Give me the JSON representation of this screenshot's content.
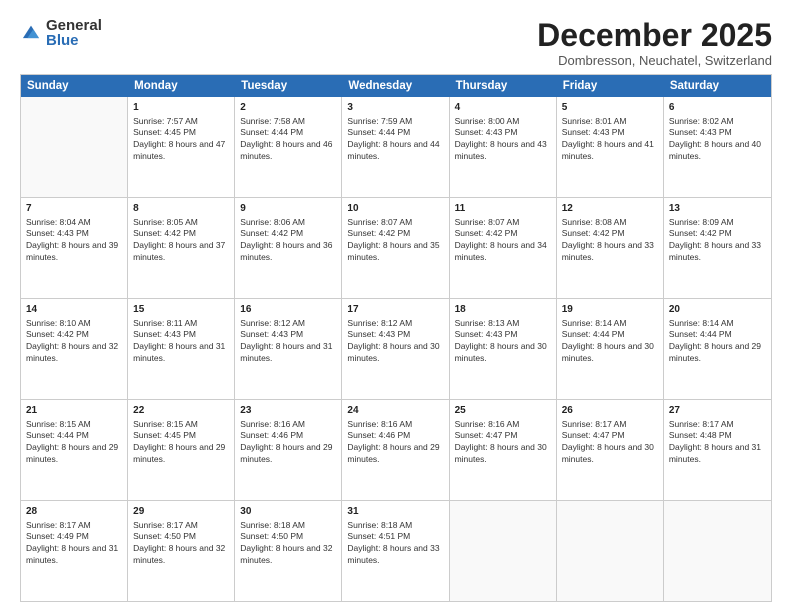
{
  "logo": {
    "general": "General",
    "blue": "Blue"
  },
  "title": {
    "month": "December 2025",
    "location": "Dombresson, Neuchatel, Switzerland"
  },
  "calendar": {
    "headers": [
      "Sunday",
      "Monday",
      "Tuesday",
      "Wednesday",
      "Thursday",
      "Friday",
      "Saturday"
    ],
    "rows": [
      [
        {
          "day": "",
          "sunrise": "",
          "sunset": "",
          "daylight": "",
          "empty": true
        },
        {
          "day": "1",
          "sunrise": "Sunrise: 7:57 AM",
          "sunset": "Sunset: 4:45 PM",
          "daylight": "Daylight: 8 hours and 47 minutes."
        },
        {
          "day": "2",
          "sunrise": "Sunrise: 7:58 AM",
          "sunset": "Sunset: 4:44 PM",
          "daylight": "Daylight: 8 hours and 46 minutes."
        },
        {
          "day": "3",
          "sunrise": "Sunrise: 7:59 AM",
          "sunset": "Sunset: 4:44 PM",
          "daylight": "Daylight: 8 hours and 44 minutes."
        },
        {
          "day": "4",
          "sunrise": "Sunrise: 8:00 AM",
          "sunset": "Sunset: 4:43 PM",
          "daylight": "Daylight: 8 hours and 43 minutes."
        },
        {
          "day": "5",
          "sunrise": "Sunrise: 8:01 AM",
          "sunset": "Sunset: 4:43 PM",
          "daylight": "Daylight: 8 hours and 41 minutes."
        },
        {
          "day": "6",
          "sunrise": "Sunrise: 8:02 AM",
          "sunset": "Sunset: 4:43 PM",
          "daylight": "Daylight: 8 hours and 40 minutes."
        }
      ],
      [
        {
          "day": "7",
          "sunrise": "Sunrise: 8:04 AM",
          "sunset": "Sunset: 4:43 PM",
          "daylight": "Daylight: 8 hours and 39 minutes."
        },
        {
          "day": "8",
          "sunrise": "Sunrise: 8:05 AM",
          "sunset": "Sunset: 4:42 PM",
          "daylight": "Daylight: 8 hours and 37 minutes."
        },
        {
          "day": "9",
          "sunrise": "Sunrise: 8:06 AM",
          "sunset": "Sunset: 4:42 PM",
          "daylight": "Daylight: 8 hours and 36 minutes."
        },
        {
          "day": "10",
          "sunrise": "Sunrise: 8:07 AM",
          "sunset": "Sunset: 4:42 PM",
          "daylight": "Daylight: 8 hours and 35 minutes."
        },
        {
          "day": "11",
          "sunrise": "Sunrise: 8:07 AM",
          "sunset": "Sunset: 4:42 PM",
          "daylight": "Daylight: 8 hours and 34 minutes."
        },
        {
          "day": "12",
          "sunrise": "Sunrise: 8:08 AM",
          "sunset": "Sunset: 4:42 PM",
          "daylight": "Daylight: 8 hours and 33 minutes."
        },
        {
          "day": "13",
          "sunrise": "Sunrise: 8:09 AM",
          "sunset": "Sunset: 4:42 PM",
          "daylight": "Daylight: 8 hours and 33 minutes."
        }
      ],
      [
        {
          "day": "14",
          "sunrise": "Sunrise: 8:10 AM",
          "sunset": "Sunset: 4:42 PM",
          "daylight": "Daylight: 8 hours and 32 minutes."
        },
        {
          "day": "15",
          "sunrise": "Sunrise: 8:11 AM",
          "sunset": "Sunset: 4:43 PM",
          "daylight": "Daylight: 8 hours and 31 minutes."
        },
        {
          "day": "16",
          "sunrise": "Sunrise: 8:12 AM",
          "sunset": "Sunset: 4:43 PM",
          "daylight": "Daylight: 8 hours and 31 minutes."
        },
        {
          "day": "17",
          "sunrise": "Sunrise: 8:12 AM",
          "sunset": "Sunset: 4:43 PM",
          "daylight": "Daylight: 8 hours and 30 minutes."
        },
        {
          "day": "18",
          "sunrise": "Sunrise: 8:13 AM",
          "sunset": "Sunset: 4:43 PM",
          "daylight": "Daylight: 8 hours and 30 minutes."
        },
        {
          "day": "19",
          "sunrise": "Sunrise: 8:14 AM",
          "sunset": "Sunset: 4:44 PM",
          "daylight": "Daylight: 8 hours and 30 minutes."
        },
        {
          "day": "20",
          "sunrise": "Sunrise: 8:14 AM",
          "sunset": "Sunset: 4:44 PM",
          "daylight": "Daylight: 8 hours and 29 minutes."
        }
      ],
      [
        {
          "day": "21",
          "sunrise": "Sunrise: 8:15 AM",
          "sunset": "Sunset: 4:44 PM",
          "daylight": "Daylight: 8 hours and 29 minutes."
        },
        {
          "day": "22",
          "sunrise": "Sunrise: 8:15 AM",
          "sunset": "Sunset: 4:45 PM",
          "daylight": "Daylight: 8 hours and 29 minutes."
        },
        {
          "day": "23",
          "sunrise": "Sunrise: 8:16 AM",
          "sunset": "Sunset: 4:46 PM",
          "daylight": "Daylight: 8 hours and 29 minutes."
        },
        {
          "day": "24",
          "sunrise": "Sunrise: 8:16 AM",
          "sunset": "Sunset: 4:46 PM",
          "daylight": "Daylight: 8 hours and 29 minutes."
        },
        {
          "day": "25",
          "sunrise": "Sunrise: 8:16 AM",
          "sunset": "Sunset: 4:47 PM",
          "daylight": "Daylight: 8 hours and 30 minutes."
        },
        {
          "day": "26",
          "sunrise": "Sunrise: 8:17 AM",
          "sunset": "Sunset: 4:47 PM",
          "daylight": "Daylight: 8 hours and 30 minutes."
        },
        {
          "day": "27",
          "sunrise": "Sunrise: 8:17 AM",
          "sunset": "Sunset: 4:48 PM",
          "daylight": "Daylight: 8 hours and 31 minutes."
        }
      ],
      [
        {
          "day": "28",
          "sunrise": "Sunrise: 8:17 AM",
          "sunset": "Sunset: 4:49 PM",
          "daylight": "Daylight: 8 hours and 31 minutes."
        },
        {
          "day": "29",
          "sunrise": "Sunrise: 8:17 AM",
          "sunset": "Sunset: 4:50 PM",
          "daylight": "Daylight: 8 hours and 32 minutes."
        },
        {
          "day": "30",
          "sunrise": "Sunrise: 8:18 AM",
          "sunset": "Sunset: 4:50 PM",
          "daylight": "Daylight: 8 hours and 32 minutes."
        },
        {
          "day": "31",
          "sunrise": "Sunrise: 8:18 AM",
          "sunset": "Sunset: 4:51 PM",
          "daylight": "Daylight: 8 hours and 33 minutes."
        },
        {
          "day": "",
          "sunrise": "",
          "sunset": "",
          "daylight": "",
          "empty": true
        },
        {
          "day": "",
          "sunrise": "",
          "sunset": "",
          "daylight": "",
          "empty": true
        },
        {
          "day": "",
          "sunrise": "",
          "sunset": "",
          "daylight": "",
          "empty": true
        }
      ]
    ]
  }
}
